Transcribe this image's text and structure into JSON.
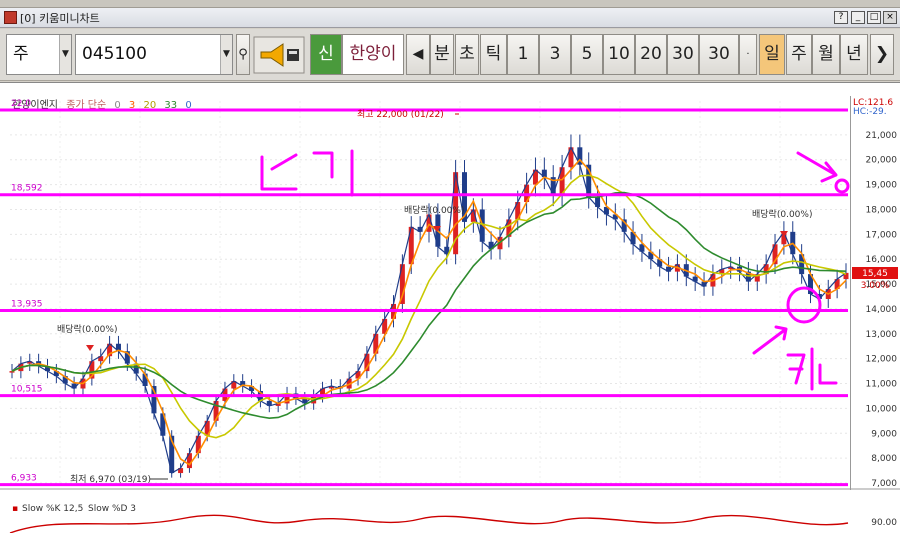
{
  "window": {
    "title": "[0] 키움미니차트"
  },
  "toolbar": {
    "type_select": "주",
    "code_input": "045100",
    "shin_btn": "신",
    "stock_name": "한양이",
    "prev_btn": "◀",
    "min_btn": "분",
    "sec_btn": "초",
    "tick_btn": "틱",
    "intervals": [
      "1",
      "3",
      "5",
      "10",
      "20",
      "30",
      "30"
    ],
    "day_btn": "일",
    "week_btn": "주",
    "month_btn": "월",
    "year_btn": "년",
    "next_btn": "❯"
  },
  "legend": {
    "name": "한양이엔지",
    "ma_label": "종가 단순",
    "ma_periods": [
      "0",
      "3",
      "20",
      "33",
      "0"
    ]
  },
  "topright": {
    "lc": "LC:121.6",
    "hc": "HC:-29."
  },
  "price_badge": {
    "price": "15,45",
    "pct": "3.00%"
  },
  "hlines": [
    {
      "value": "22,0",
      "price": 22000
    },
    {
      "value": "18,592",
      "price": 18592
    },
    {
      "value": "13,935",
      "price": 13935
    },
    {
      "value": "10,515",
      "price": 10515
    },
    {
      "value": "6,933",
      "price": 6933
    }
  ],
  "annotations": {
    "high": "최고 22,000 (01/22)",
    "low": "최저 6,970 (03/19)",
    "div1": "배당락(0.00%)",
    "div2": "배당락(0.00%)",
    "div3": "배당락(0.00%)"
  },
  "handwriting": {
    "top": "ㄷ1ㄱ",
    "bottom": "ㅋ1ㄴ"
  },
  "stoch": {
    "label_k": "Slow %K 12,5",
    "label_d": "Slow %D 3",
    "axis": "90.00"
  },
  "colors": {
    "hline": "#ff00ff",
    "ma_short": "#ff8c00",
    "ma_mid": "#c8c800",
    "ma_long": "#2e8b2e",
    "candle": "#1f3d8a"
  },
  "chart_data": {
    "type": "line",
    "title": "",
    "ylabel": "",
    "yticks": [
      "21,000",
      "20,000",
      "19,000",
      "18,000",
      "17,000",
      "16,000",
      "15,000",
      "14,000",
      "13,000",
      "12,000",
      "11,000",
      "10,000",
      "9,000",
      "8,000",
      "7,000"
    ],
    "ylim": [
      6800,
      22000
    ],
    "series": [
      {
        "values": [
          11500,
          11800,
          11900,
          11700,
          11500,
          11300,
          11000,
          10800,
          11200,
          11900,
          12100,
          12600,
          12300,
          11800,
          11400,
          10900,
          9800,
          8900,
          7400,
          7600,
          8200,
          8900,
          9500,
          10300,
          10800,
          11100,
          10900,
          10700,
          10300,
          10100,
          10200,
          10600,
          10400,
          10200,
          10500,
          10800,
          10900,
          10800,
          11200,
          11500,
          12200,
          13000,
          13600,
          14200,
          15800,
          17300,
          17100,
          17800,
          16500,
          16200,
          19500,
          17500,
          18000,
          16700,
          16400,
          16900,
          17600,
          18300,
          19000,
          19600,
          19300,
          18600,
          19700,
          20500,
          19800,
          18500,
          18100,
          17800,
          17600,
          17100,
          16600,
          16300,
          16000,
          15700,
          15500,
          15800,
          15300,
          15100,
          14900,
          15400,
          15600,
          15700,
          15500,
          15100,
          15400,
          15800,
          16600,
          17100,
          16200,
          15400,
          14600,
          14400,
          14800,
          15200,
          15450
        ]
      }
    ]
  }
}
